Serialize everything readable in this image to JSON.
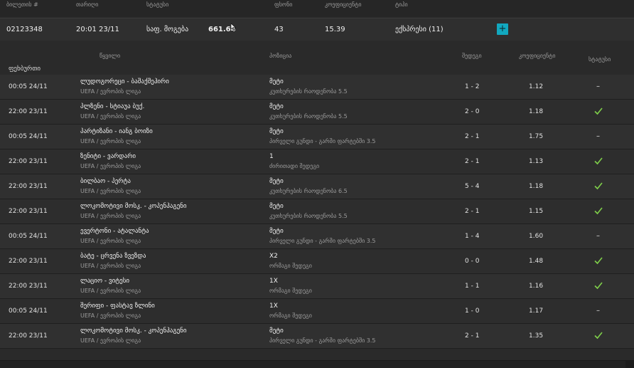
{
  "ticket_header": {
    "ticket_no": "ბილეთის #",
    "date": "თარიღი",
    "status": "სტატუსი",
    "stake": "ფსონი",
    "coefficient": "კოეფიციენტი",
    "type": "ტიპი"
  },
  "ticket": {
    "id": "02123348",
    "date": "20:01 23/11",
    "status": "საფ. მოგება",
    "payout": "661.64",
    "stake": "43",
    "coefficient": "15.39",
    "type": "ექსპრესი (11)",
    "add_label": "+"
  },
  "detail_header": {
    "event": "წყვილი",
    "pick": "პოზიცია",
    "score": "შედეგი",
    "odds": "კოეფიციენტი",
    "status": "სტატუსი",
    "section_title": "ფეხბურთი"
  },
  "rows": [
    {
      "date": "00:05 24/11",
      "event": "ლუდოგორეცი - ბაშაქშეჰირი",
      "league": "UEFA / ევროპის ლიგა",
      "pick": "მეტი",
      "market": "კუთხურების რაოდენობა 5.5",
      "score": "1 - 2",
      "odds": "1.12",
      "status": "pending"
    },
    {
      "date": "22:00 23/11",
      "event": "პლზენი - სტიაუა ბუქ.",
      "league": "UEFA / ევროპის ლიგა",
      "pick": "მეტი",
      "market": "კუთხურების რაოდენობა 5.5",
      "score": "2 - 0",
      "odds": "1.18",
      "status": "won"
    },
    {
      "date": "00:05 24/11",
      "event": "პარტიზანი - იანგ ბოიზი",
      "league": "UEFA / ევროპის ლიგა",
      "pick": "მეტი",
      "market": "პირველი გუნდი - გარში ფარტებში 3.5",
      "score": "2 - 1",
      "odds": "1.75",
      "status": "pending"
    },
    {
      "date": "22:00 23/11",
      "event": "ზენიტი - ვარდარი",
      "league": "UEFA / ევროპის ლიგა",
      "pick": "1",
      "market": "ძირითადი შედეგი",
      "score": "2 - 1",
      "odds": "1.13",
      "status": "won"
    },
    {
      "date": "22:00 23/11",
      "event": "ბილბაო - პერტა",
      "league": "UEFA / ევროპის ლიგა",
      "pick": "მეტი",
      "market": "კუთხურების რაოდენობა 6.5",
      "score": "5 - 4",
      "odds": "1.18",
      "status": "won"
    },
    {
      "date": "22:00 23/11",
      "event": "ლოკომოტივი მოსკ. - კოპენჰაგენი",
      "league": "UEFA / ევროპის ლიგა",
      "pick": "მეტი",
      "market": "კუთხურების რაოდენობა 5.5",
      "score": "2 - 1",
      "odds": "1.15",
      "status": "won"
    },
    {
      "date": "00:05 24/11",
      "event": "ევერტონი - ატალანტა",
      "league": "UEFA / ევროპის ლიგა",
      "pick": "მეტი",
      "market": "პირველი გუნდი - გარში ფარტებში 3.5",
      "score": "1 - 4",
      "odds": "1.60",
      "status": "pending"
    },
    {
      "date": "22:00 23/11",
      "event": "ბატე - ცრვენა ზვეზდა",
      "league": "UEFA / ევროპის ლიგა",
      "pick": "X2",
      "market": "ორმაგი შედეგი",
      "score": "0 - 0",
      "odds": "1.48",
      "status": "won"
    },
    {
      "date": "22:00 23/11",
      "event": "ლაციო - ვიტესი",
      "league": "UEFA / ევროპის ლიგა",
      "pick": "1X",
      "market": "ორმაგი შედეგი",
      "score": "1 - 1",
      "odds": "1.16",
      "status": "won"
    },
    {
      "date": "00:05 24/11",
      "event": "შერიფი - ფასტავ ზლინი",
      "league": "UEFA / ევროპის ლიგა",
      "pick": "1X",
      "market": "ორმაგი შედეგი",
      "score": "1 - 0",
      "odds": "1.17",
      "status": "pending"
    },
    {
      "date": "22:00 23/11",
      "event": "ლოკომოტივი მოსკ. - კოპენჰაგენი",
      "league": "UEFA / ევროპის ლიგა",
      "pick": "მეტი",
      "market": "პირველი გუნდი - გარში ფარტებში 3.5",
      "score": "2 - 1",
      "odds": "1.35",
      "status": "won"
    }
  ],
  "status_symbols": {
    "pending": "–"
  },
  "colors": {
    "accent": "#12a8bf",
    "check": "#7fcf4a",
    "background": "#2b2b2b"
  }
}
